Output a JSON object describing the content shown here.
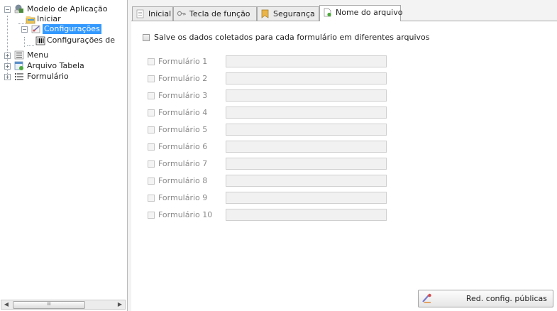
{
  "tree": {
    "root": {
      "label": "Modelo de Aplicação",
      "icon": "app-model-icon",
      "expanded": true
    },
    "items": [
      {
        "label": "Iniciar",
        "icon": "start-folder-icon"
      },
      {
        "label": "Configurações",
        "icon": "settings-icon",
        "selected": true,
        "expanded": true,
        "children": [
          {
            "label": "Configurações de",
            "icon": "barcode-icon"
          }
        ]
      },
      {
        "label": "Menu",
        "icon": "menu-icon",
        "expanded": false
      },
      {
        "label": "Arquivo Tabela",
        "icon": "table-file-icon",
        "expanded": false
      },
      {
        "label": "Formulário",
        "icon": "form-icon",
        "expanded": false
      }
    ],
    "scrollbar": {
      "thumb_grip": "III"
    }
  },
  "tabs": [
    {
      "label": "Inicial",
      "icon": "page-icon",
      "active": false
    },
    {
      "label": "Tecla de função",
      "icon": "key-icon",
      "active": false
    },
    {
      "label": "Segurança",
      "icon": "security-icon",
      "active": false
    },
    {
      "label": "Nome do arquivo",
      "icon": "file-name-icon",
      "active": true
    }
  ],
  "content": {
    "save_separate_label": "Salve os dados coletados para cada formulário em diferentes arquivos",
    "save_separate_checked": false,
    "forms": [
      {
        "label": "Formulário 1",
        "value": ""
      },
      {
        "label": "Formulário 2",
        "value": ""
      },
      {
        "label": "Formulário 3",
        "value": ""
      },
      {
        "label": "Formulário 4",
        "value": ""
      },
      {
        "label": "Formulário 5",
        "value": ""
      },
      {
        "label": "Formulário 6",
        "value": ""
      },
      {
        "label": "Formulário 7",
        "value": ""
      },
      {
        "label": "Formulário 8",
        "value": ""
      },
      {
        "label": "Formulário 9",
        "value": ""
      },
      {
        "label": "Formulário 10",
        "value": ""
      }
    ],
    "reset_button_label": "Red. config. públicas",
    "reset_button_icon": "reset-icon"
  },
  "colors": {
    "selection": "#3399ff",
    "accent_border": "#a9a9a9"
  }
}
